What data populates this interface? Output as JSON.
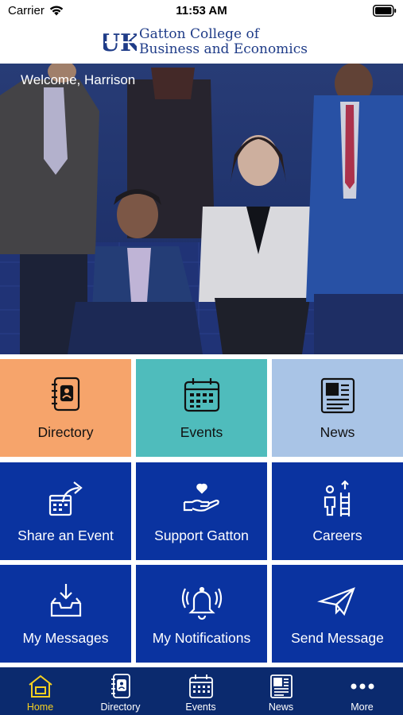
{
  "status_bar": {
    "carrier": "Carrier",
    "time": "11:53 AM"
  },
  "header": {
    "logo_mark": "UK",
    "logo_line1": "Gatton College of",
    "logo_line2": "Business and Economics"
  },
  "hero": {
    "welcome": "Welcome, Harrison"
  },
  "tiles": [
    {
      "label": "Directory",
      "icon": "address-book-icon",
      "bg": "#f6a46b",
      "style": "light"
    },
    {
      "label": "Events",
      "icon": "calendar-icon",
      "bg": "#4fbcbc",
      "style": "light"
    },
    {
      "label": "News",
      "icon": "newspaper-icon",
      "bg": "#a9c4e6",
      "style": "light"
    },
    {
      "label": "Share an Event",
      "icon": "share-event-icon",
      "bg": "#0a33a0",
      "style": "dark"
    },
    {
      "label": "Support Gatton",
      "icon": "heart-hand-icon",
      "bg": "#0a33a0",
      "style": "dark"
    },
    {
      "label": "Careers",
      "icon": "career-ladder-icon",
      "bg": "#0a33a0",
      "style": "dark"
    },
    {
      "label": "My Messages",
      "icon": "inbox-icon",
      "bg": "#0a33a0",
      "style": "dark"
    },
    {
      "label": "My Notifications",
      "icon": "bell-icon",
      "bg": "#0a33a0",
      "style": "dark"
    },
    {
      "label": "Send Message",
      "icon": "paper-plane-icon",
      "bg": "#0a33a0",
      "style": "dark"
    }
  ],
  "tabbar": {
    "items": [
      {
        "label": "Home",
        "icon": "home-icon",
        "active": true
      },
      {
        "label": "Directory",
        "icon": "address-book-icon",
        "active": false
      },
      {
        "label": "Events",
        "icon": "calendar-icon",
        "active": false
      },
      {
        "label": "News",
        "icon": "newspaper-icon",
        "active": false
      },
      {
        "label": "More",
        "icon": "more-dots-icon",
        "active": false
      }
    ]
  },
  "colors": {
    "brand_blue": "#1f3c88",
    "tile_dark": "#0a33a0",
    "tabbar_bg": "#0b2a6e",
    "tab_active": "#f5d020"
  }
}
